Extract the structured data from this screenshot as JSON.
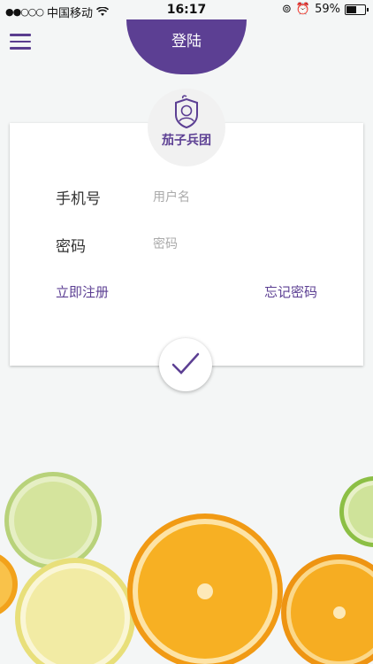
{
  "status_bar": {
    "signal": "●●○○○",
    "carrier": "中国移动",
    "time": "16:17",
    "battery": "59%",
    "battery_level": 0.59
  },
  "header": {
    "menu_icon": "hamburger-menu-icon",
    "title": "登陆"
  },
  "logo": {
    "text": "茄子兵团",
    "icon": "eggplant-mascot-icon"
  },
  "form": {
    "phone_label": "手机号",
    "phone_placeholder": "用户名",
    "password_label": "密码",
    "password_placeholder": "密码",
    "register_link": "立即注册",
    "forgot_link": "忘记密码"
  },
  "submit": {
    "icon": "check-icon"
  },
  "colors": {
    "accent": "#5c3f93",
    "background": "#f4f6f6"
  }
}
